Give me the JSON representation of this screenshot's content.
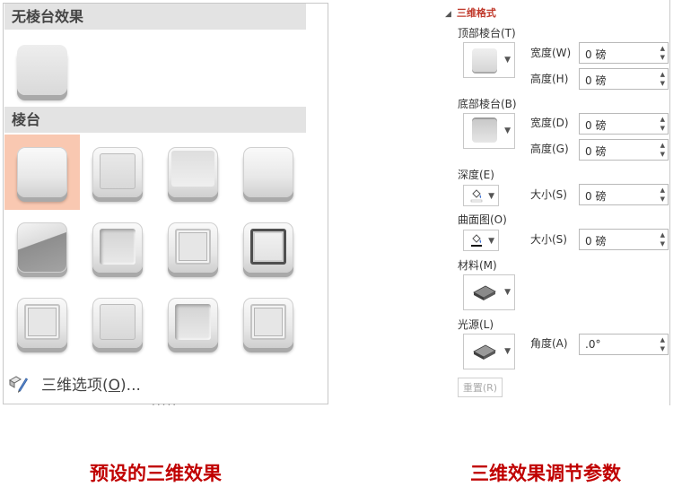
{
  "gallery": {
    "no_bevel_title": "无棱台效果",
    "bevel_title": "棱台",
    "options_label": "三维选项",
    "options_hotkey": "O",
    "options_suffix": "...",
    "grip": "....."
  },
  "pane": {
    "title": "三维格式",
    "top_bevel": "顶部棱台(T)",
    "bottom_bevel": "底部棱台(B)",
    "width_label": "宽度(W)",
    "height_label": "高度(H)",
    "bottom_width_label": "宽度(D)",
    "bottom_height_label": "高度(G)",
    "depth": "深度(E)",
    "depth_size_label": "大小(S)",
    "contour": "曲面图(O)",
    "contour_size_label": "大小(S)",
    "material": "材料(M)",
    "lighting": "光源(L)",
    "angle_label": "角度(A)",
    "top_width": "0 磅",
    "top_height": "0 磅",
    "bottom_width": "0 磅",
    "bottom_height": "0 磅",
    "depth_size": "0 磅",
    "contour_size": "0 磅",
    "angle": ".0°",
    "reset": "重置(R)"
  },
  "captions": {
    "left": "预设的三维效果",
    "right": "三维效果调节参数"
  },
  "colors": {
    "selected_tile": "#f9c8b1",
    "caption": "#c00000",
    "pane_title": "#c0392b"
  }
}
